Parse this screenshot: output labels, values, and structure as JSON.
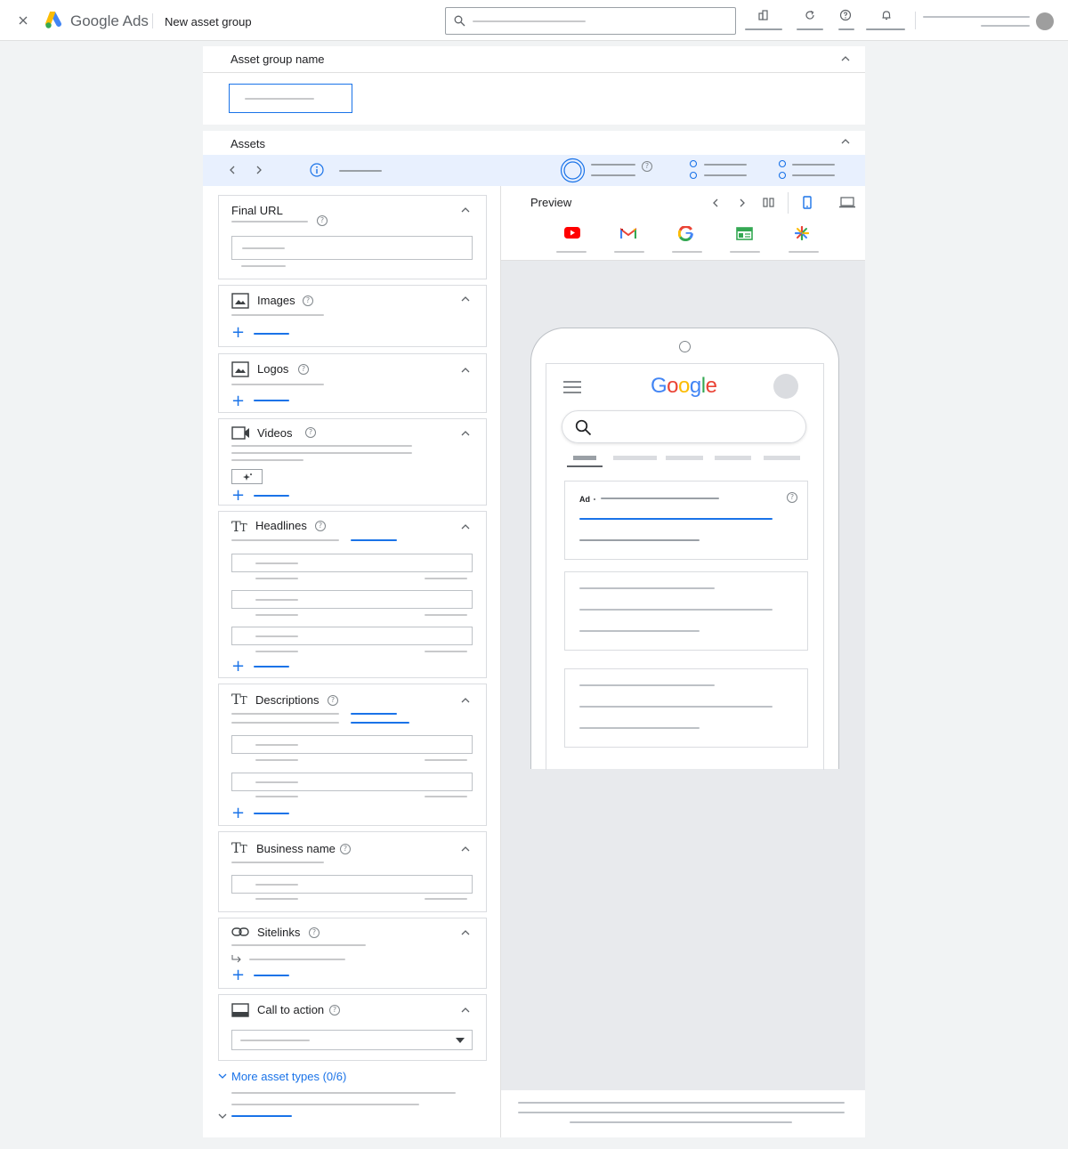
{
  "header": {
    "app_name": "Google Ads",
    "page_title": "New asset group"
  },
  "asset_group_section": {
    "title": "Asset group name"
  },
  "assets_section": {
    "title": "Assets"
  },
  "asset_cards": {
    "final_url": "Final URL",
    "images": "Images",
    "logos": "Logos",
    "videos": "Videos",
    "headlines": "Headlines",
    "descriptions": "Descriptions",
    "business_name": "Business name",
    "sitelinks": "Sitelinks",
    "call_to_action": "Call to action",
    "more_asset_types": "More asset types (0/6)"
  },
  "preview": {
    "title": "Preview",
    "ad_label": "Ad",
    "logo_letters": [
      "G",
      "o",
      "o",
      "g",
      "l",
      "e"
    ],
    "logo_colors": [
      "#4285f4",
      "#ea4335",
      "#fbbc05",
      "#4285f4",
      "#34a853",
      "#ea4335"
    ],
    "channels": [
      "youtube-icon",
      "gmail-icon",
      "google-search-icon",
      "display-icon",
      "discover-icon"
    ]
  },
  "colors": {
    "accent": "#1a73e8",
    "selected_row_bg": "#e8f0fe"
  }
}
